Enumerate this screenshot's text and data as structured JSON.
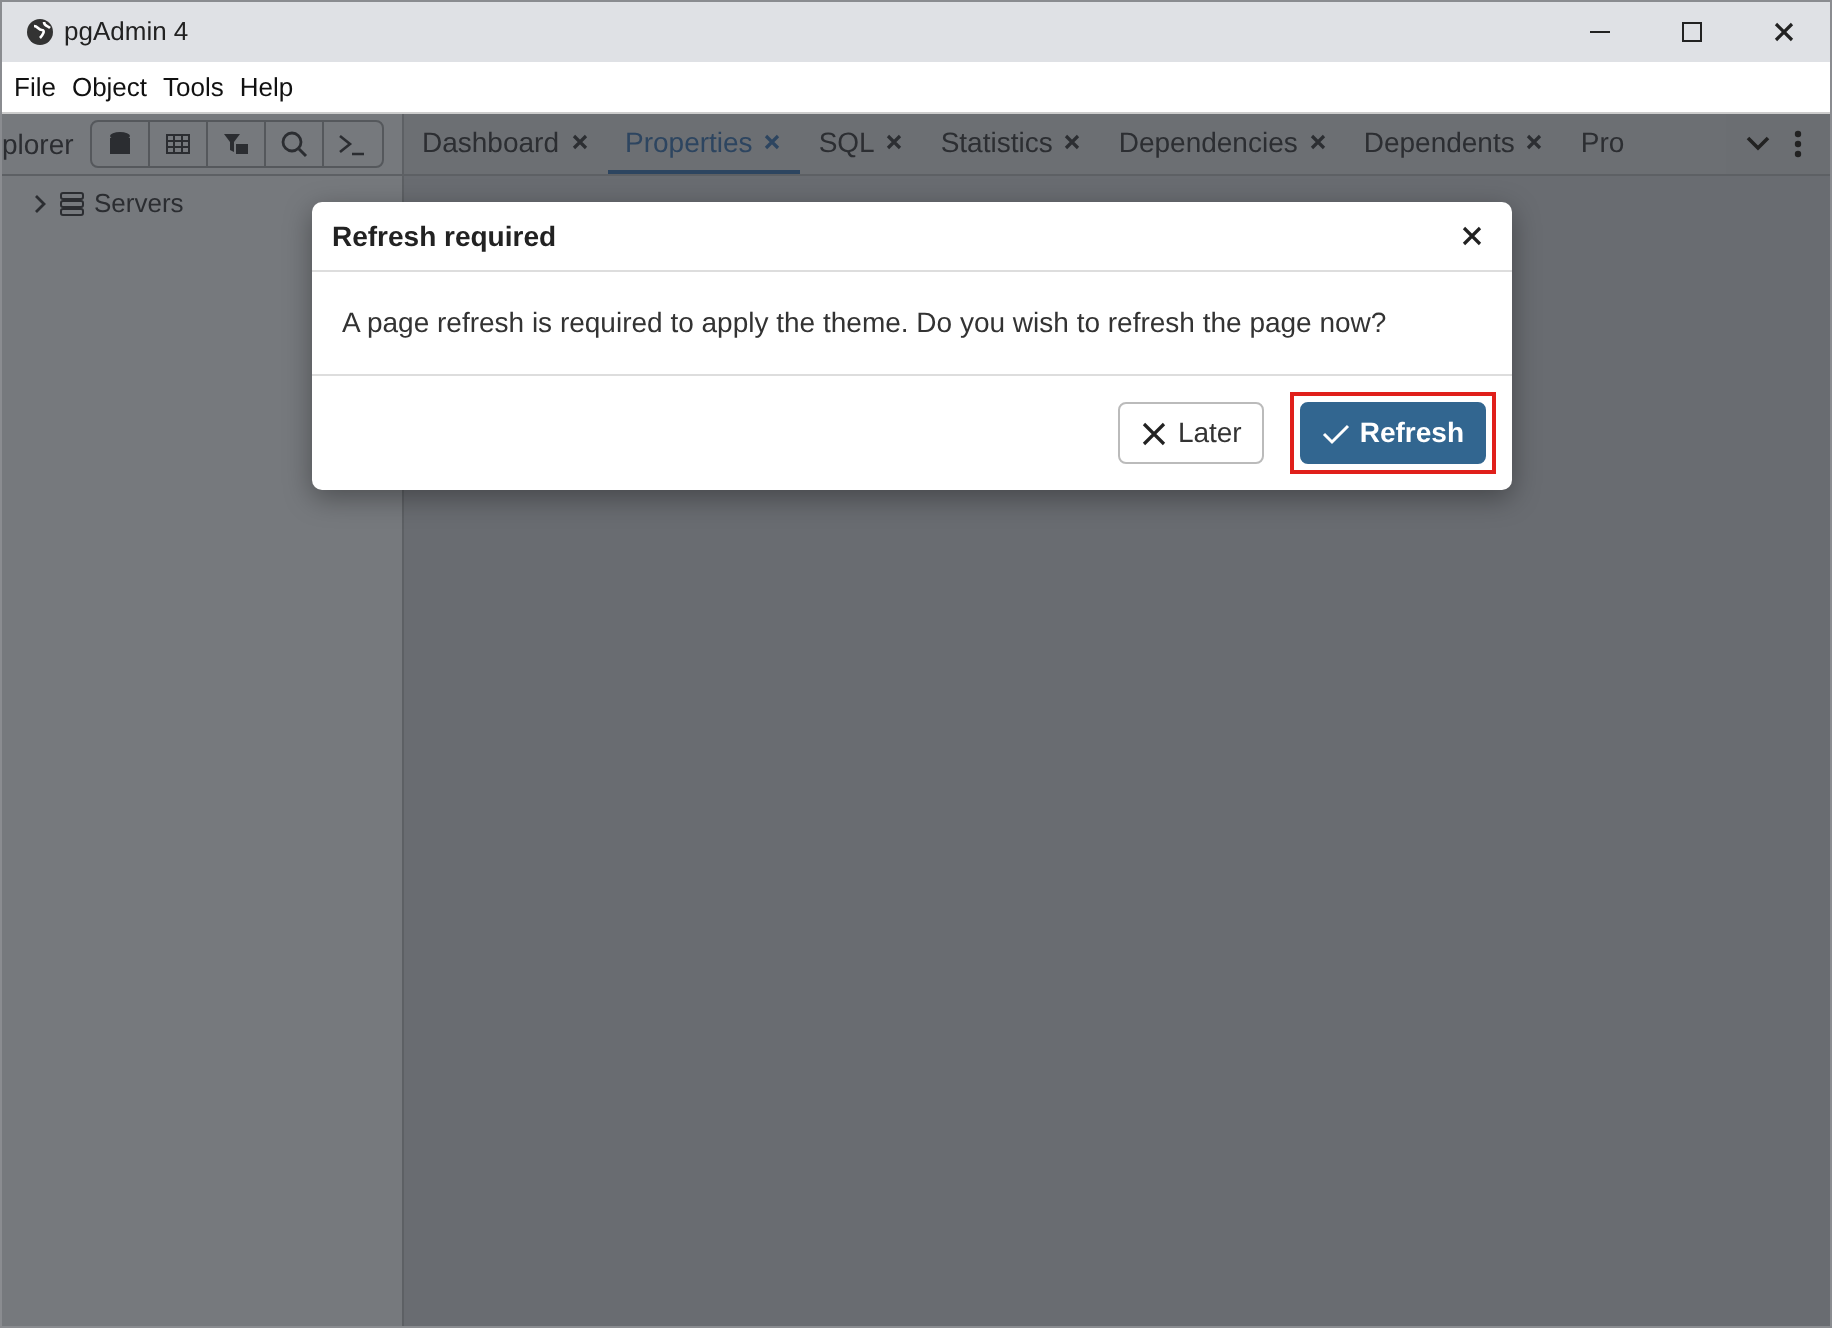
{
  "window": {
    "title": "pgAdmin 4"
  },
  "menu": [
    "File",
    "Object",
    "Tools",
    "Help"
  ],
  "sidebar": {
    "title": "plorer",
    "tree": [
      {
        "label": "Servers",
        "expanded": false
      }
    ]
  },
  "tabs": [
    {
      "label": "Dashboard",
      "selected": false,
      "closable": true
    },
    {
      "label": "Properties",
      "selected": true,
      "closable": true
    },
    {
      "label": "SQL",
      "selected": false,
      "closable": true
    },
    {
      "label": "Statistics",
      "selected": false,
      "closable": true
    },
    {
      "label": "Dependencies",
      "selected": false,
      "closable": true
    },
    {
      "label": "Dependents",
      "selected": false,
      "closable": true
    },
    {
      "label": "Pro",
      "selected": false,
      "closable": false
    }
  ],
  "dialog": {
    "title": "Refresh required",
    "message": "A page refresh is required to apply the theme. Do you wish to refresh the page now?",
    "buttons": [
      {
        "label": "Later",
        "kind": "secondary",
        "highlighted": false
      },
      {
        "label": "Refresh",
        "kind": "primary",
        "highlighted": true
      }
    ]
  }
}
